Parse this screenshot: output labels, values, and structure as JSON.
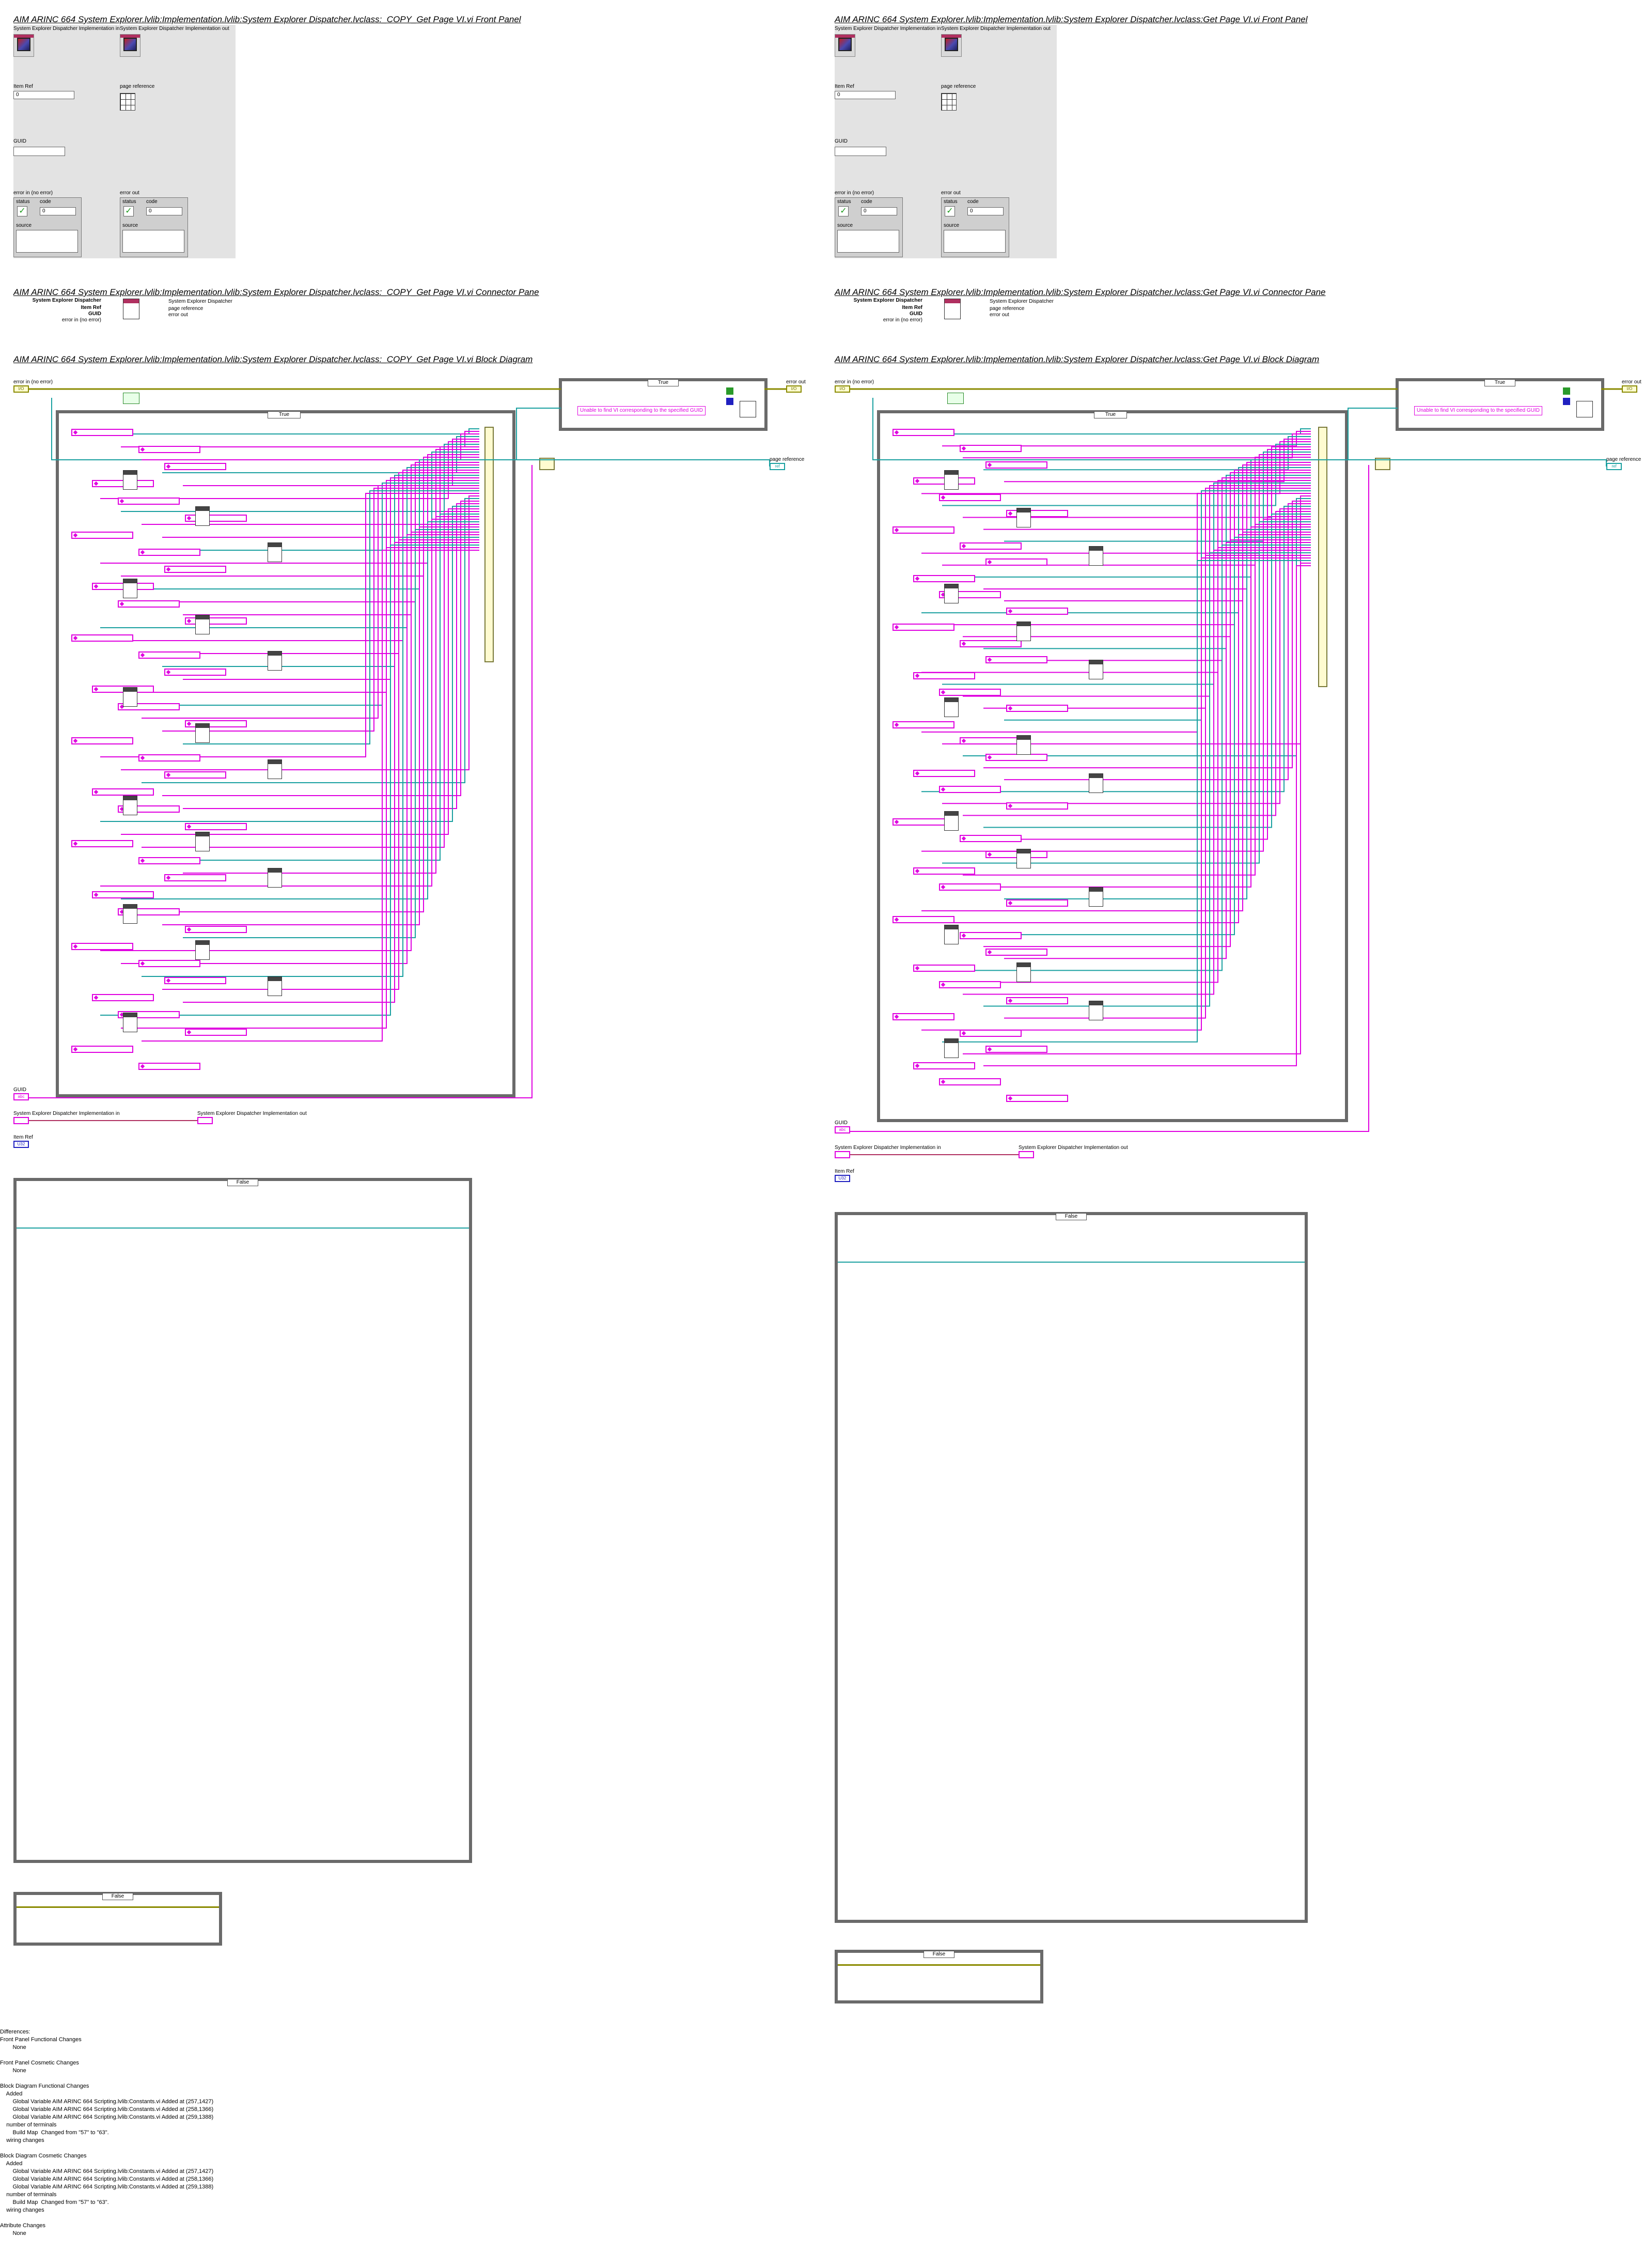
{
  "left": {
    "front_panel_title": "AIM ARINC 664 System Explorer.lvlib:Implementation.lvlib:System Explorer Dispatcher.lvclass:_COPY_Get Page VI.vi Front Panel",
    "connector_title": "AIM ARINC 664 System Explorer.lvlib:Implementation.lvlib:System Explorer Dispatcher.lvclass:_COPY_Get Page VI.vi Connector Pane",
    "block_title": "AIM ARINC 664 System Explorer.lvlib:Implementation.lvlib:System Explorer Dispatcher.lvclass:_COPY_Get Page VI.vi Block Diagram"
  },
  "right": {
    "front_panel_title": "AIM ARINC 664 System Explorer.lvlib:Implementation.lvlib:System Explorer Dispatcher.lvclass:Get Page VI.vi Front Panel",
    "connector_title": "AIM ARINC 664 System Explorer.lvlib:Implementation.lvlib:System Explorer Dispatcher.lvclass:Get Page VI.vi Connector Pane",
    "block_title": "AIM ARINC 664 System Explorer.lvlib:Implementation.lvlib:System Explorer Dispatcher.lvclass:Get Page VI.vi Block Diagram"
  },
  "front_panel": {
    "impl_in": "System Explorer Dispatcher Implementation in",
    "impl_out": "System Explorer Dispatcher Implementation out",
    "item_ref": "Item Ref",
    "item_ref_value": "0",
    "page_reference": "page reference",
    "guid": "GUID",
    "error_in": "error in (no error)",
    "error_out": "error out",
    "status": "status",
    "code": "code",
    "code_value": "0",
    "source": "source"
  },
  "connector": {
    "left_labels": [
      "System Explorer Dispatcher",
      "Item Ref",
      "GUID",
      "error in (no error)"
    ],
    "right_labels": [
      "System Explorer Dispatcher",
      "page reference",
      "error out"
    ]
  },
  "block": {
    "error_in": "error in (no error)",
    "error_out": "error out",
    "page_reference": "page reference",
    "true_case": "True",
    "false_case": "False",
    "error_message": "Unable to find VI corresponding to the specified GUID",
    "guid": "GUID",
    "impl_in": "System Explorer Dispatcher Implementation in",
    "impl_out": "System Explorer Dispatcher Implementation out",
    "item_ref": "Item Ref"
  },
  "differences": {
    "lines": [
      "Differences:",
      "Front Panel Functional Changes",
      "        None",
      "",
      "Front Panel Cosmetic Changes",
      "        None",
      "",
      "Block Diagram Functional Changes",
      "    Added",
      "        Global Variable AIM ARINC 664 Scripting.lvlib:Constants.vi Added at (257,1427)",
      "        Global Variable AIM ARINC 664 Scripting.lvlib:Constants.vi Added at (258,1366)",
      "        Global Variable AIM ARINC 664 Scripting.lvlib:Constants.vi Added at (259,1388)",
      "    number of terminals",
      "        Build Map  Changed from \"57\" to \"63\".",
      "    wiring changes",
      "",
      "Block Diagram Cosmetic Changes",
      "    Added",
      "        Global Variable AIM ARINC 664 Scripting.lvlib:Constants.vi Added at (257,1427)",
      "        Global Variable AIM ARINC 664 Scripting.lvlib:Constants.vi Added at (258,1366)",
      "        Global Variable AIM ARINC 664 Scripting.lvlib:Constants.vi Added at (259,1388)",
      "    number of terminals",
      "        Build Map  Changed from \"57\" to \"63\".",
      "    wiring changes",
      "",
      "Attribute Changes",
      "        None"
    ]
  },
  "colors": {
    "guid_pink": "#e000e0",
    "wire_teal": "#1aa0a0",
    "error_wire": "#8a8a00",
    "frame_gray": "#6a6a6a"
  }
}
